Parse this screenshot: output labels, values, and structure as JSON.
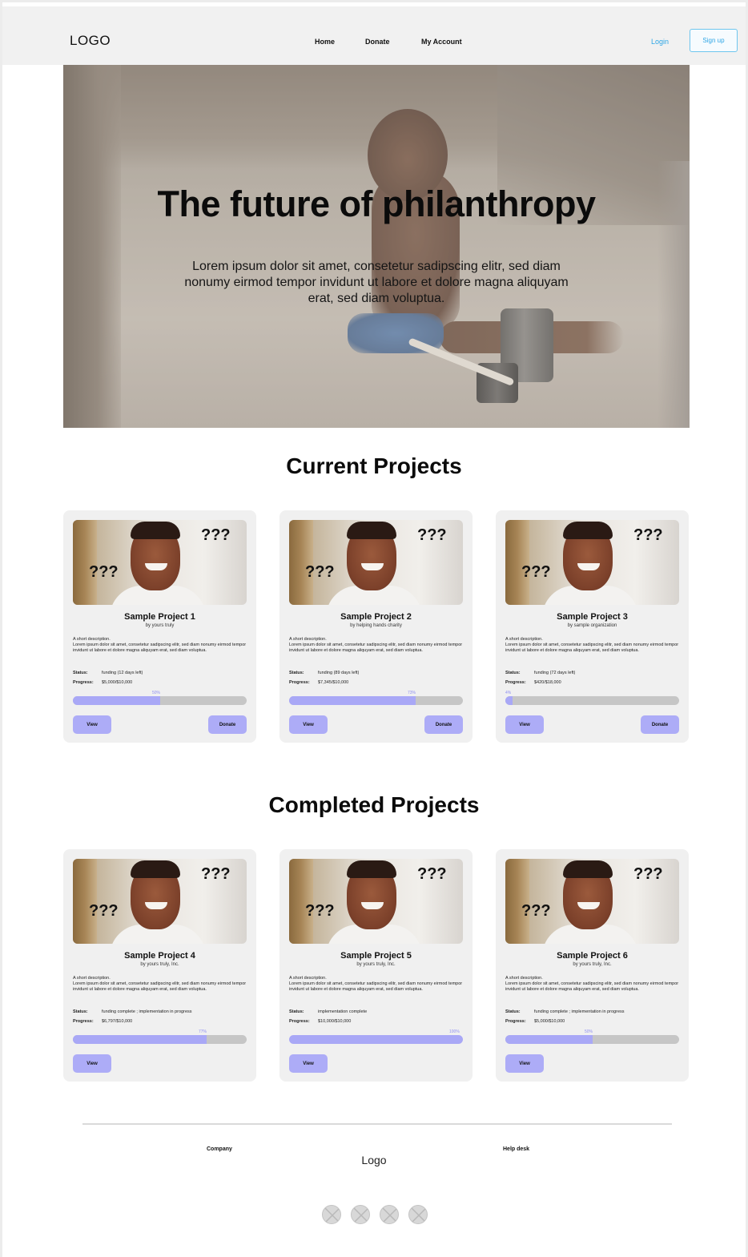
{
  "header": {
    "logo": "LOGO",
    "nav": [
      "Home",
      "Donate",
      "My Account"
    ],
    "login": "Login",
    "signup": "Sign up"
  },
  "hero": {
    "title": "The future of philanthropy",
    "subtitle": "Lorem ipsum dolor sit amet, consetetur sadipscing elitr, sed diam nonumy eirmod tempor invidunt ut labore et dolore magna aliquyam erat, sed diam voluptua."
  },
  "current": {
    "heading": "Current Projects",
    "projects": [
      {
        "title": "Sample Project 1",
        "by": "by yours truly",
        "desc": "A short description.\nLorem ipsum dolor sit amet, consetetur sadipscing elitr, sed diam nonumy eirmod tempor invidunt ut labore et dolore magna aliquyam erat, sed diam voluptua.",
        "status_label": "Status:",
        "status": "funding (12 days left)",
        "progress_label": "Progress:",
        "progress_text": "$5,000/$10,000",
        "percent_label": "50%",
        "progress": 0.5,
        "view": "View",
        "donate": "Donate"
      },
      {
        "title": "Sample Project 2",
        "by": "by helping hands charity",
        "desc": "A short description.\nLorem ipsum dolor sit amet, consetetur sadipscing elitr, sed diam nonumy eirmod tempor invidunt ut labore et dolore magna aliquyam erat, sed diam voluptua.",
        "status_label": "Status:",
        "status": "funding (89 days left)",
        "progress_label": "Progress:",
        "progress_text": "$7,345/$10,000",
        "percent_label": "73%",
        "progress": 0.73,
        "view": "View",
        "donate": "Donate"
      },
      {
        "title": "Sample Project 3",
        "by": "by sample organization",
        "desc": "A short description.\nLorem ipsum dolor sit amet, consetetur sadipscing elitr, sed diam nonumy eirmod tempor invidunt ut labore et dolore magna aliquyam erat, sed diam voluptua.",
        "status_label": "Status:",
        "status": "funding (72 days left)",
        "progress_label": "Progress:",
        "progress_text": "$420/$18,000",
        "percent_label": "4%",
        "progress": 0.04,
        "view": "View",
        "donate": "Donate"
      }
    ]
  },
  "completed": {
    "heading": "Completed Projects",
    "projects": [
      {
        "title": "Sample Project 4",
        "by": "by yours truly, Inc.",
        "desc": "A short description.\nLorem ipsum dolor sit amet, consetetur sadipscing elitr, sed diam nonumy eirmod tempor invidunt ut labore et dolore magna aliquyam erat, sed diam voluptua.",
        "status_label": "Status:",
        "status": "funding complete ; implementation in progress",
        "progress_label": "Progress:",
        "progress_text": "$6,797/$10,000",
        "percent_label": "77%",
        "progress": 0.77,
        "view": "View"
      },
      {
        "title": "Sample Project 5",
        "by": "by yours truly, Inc.",
        "desc": "A short description.\nLorem ipsum dolor sit amet, consetetur sadipscing elitr, sed diam nonumy eirmod tempor invidunt ut labore et dolore magna aliquyam erat, sed diam voluptua.",
        "status_label": "Status:",
        "status": "implementation complete",
        "progress_label": "Progress:",
        "progress_text": "$10,000/$10,000",
        "percent_label": "100%",
        "progress": 1.0,
        "view": "View"
      },
      {
        "title": "Sample Project 6",
        "by": "by yours truly, Inc.",
        "desc": "A short description.\nLorem ipsum dolor sit amet, consetetur sadipscing elitr, sed diam nonumy eirmod tempor invidunt ut labore et dolore magna aliquyam erat, sed diam voluptua.",
        "status_label": "Status:",
        "status": "funding complete ; implementation in progress",
        "progress_label": "Progress:",
        "progress_text": "$5,000/$10,000",
        "percent_label": "50%",
        "progress": 0.5,
        "view": "View"
      }
    ]
  },
  "footer": {
    "company": "Company",
    "logo": "Logo",
    "help": "Help desk",
    "social_icons": [
      "social-icon-1",
      "social-icon-2",
      "social-icon-3",
      "social-icon-4"
    ]
  },
  "colors": {
    "accent": "#adacf7",
    "progress_fill": "#a9a8f6",
    "link": "#2ea6e6",
    "card_bg": "#f0f0f0"
  }
}
